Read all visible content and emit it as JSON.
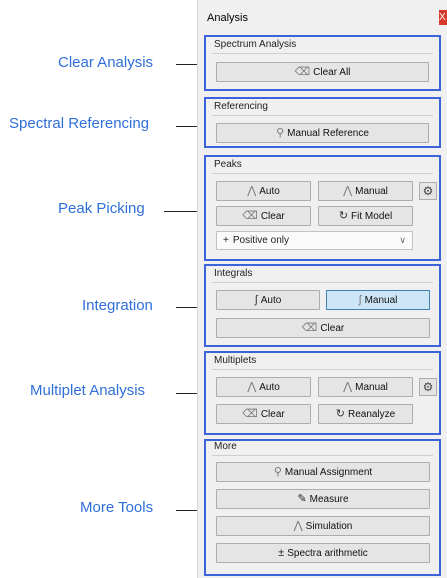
{
  "panel": {
    "title": "Analysis",
    "close_label": "X"
  },
  "annotations": {
    "clear_analysis": "Clear Analysis",
    "spectral_referencing": "Spectral Referencing",
    "peak_picking": "Peak Picking",
    "integration": "Integration",
    "multiplet_analysis": "Multiplet Analysis",
    "more_tools": "More Tools"
  },
  "spectrum_analysis": {
    "title": "Spectrum Analysis",
    "clear_all": "Clear All"
  },
  "referencing": {
    "title": "Referencing",
    "manual_reference": "Manual Reference"
  },
  "peaks": {
    "title": "Peaks",
    "auto": "Auto",
    "manual": "Manual",
    "clear": "Clear",
    "fit_model": "Fit Model",
    "filter_selected": "Positive only"
  },
  "integrals": {
    "title": "Integrals",
    "auto": "Auto",
    "manual": "Manual",
    "clear": "Clear"
  },
  "multiplets": {
    "title": "Multiplets",
    "auto": "Auto",
    "manual": "Manual",
    "clear": "Clear",
    "reanalyze": "Reanalyze"
  },
  "more": {
    "title": "More",
    "manual_assignment": "Manual Assignment",
    "measure": "Measure",
    "simulation": "Simulation",
    "spectra_arithmetic": "Spectra arithmetic"
  },
  "colors": {
    "accent_border": "#3d63d9",
    "annotation_text": "#2f6fd9",
    "active_button": "#cde6f7"
  }
}
